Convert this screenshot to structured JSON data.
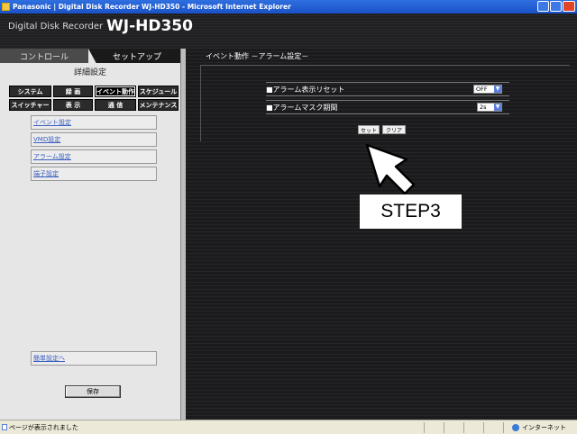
{
  "window": {
    "title": "Panasonic | Digital Disk Recorder WJ-HD350 - Microsoft Internet Explorer"
  },
  "app": {
    "name": "Digital Disk Recorder",
    "model": "WJ-HD350"
  },
  "tabs": [
    {
      "label": "コントロール"
    },
    {
      "label": "セットアップ"
    }
  ],
  "sidebar": {
    "subtitle": "詳細設定",
    "categories": [
      {
        "label": "システム"
      },
      {
        "label": "録 画"
      },
      {
        "label": "イベント動作"
      },
      {
        "label": "スケジュール"
      },
      {
        "label": "スイッチャー"
      },
      {
        "label": "表 示"
      },
      {
        "label": "通 信"
      },
      {
        "label": "メンテナンス"
      }
    ],
    "items": [
      {
        "label": "イベント設定"
      },
      {
        "label": "VMD設定"
      },
      {
        "label": "アラーム設定"
      },
      {
        "label": "端子設定"
      }
    ],
    "easy_setup": "簡単設定へ",
    "save_label": "保存"
  },
  "main": {
    "title": "イベント動作 －アラーム設定－",
    "settings": [
      {
        "label": "■アラーム表示リセット",
        "value": "OFF"
      },
      {
        "label": "■アラームマスク期間",
        "value": "2s"
      }
    ],
    "set_label": "セット",
    "clear_label": "クリア"
  },
  "annotation": {
    "step_label": "STEP3"
  },
  "statusbar": {
    "text": "ページが表示されました",
    "zone": "インターネット"
  },
  "colors": {
    "titlebar": "#1a52c6",
    "background_dark": "#1b1b1d",
    "link": "#3a5fbf"
  },
  "icons": [
    "ie-icon",
    "minimize-icon",
    "maximize-icon",
    "close-icon",
    "dropdown-arrow-icon",
    "cursor-arrow-icon",
    "globe-icon",
    "page-icon"
  ]
}
